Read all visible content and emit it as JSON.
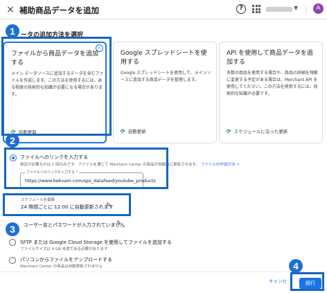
{
  "header": {
    "close_icon": "×",
    "title": "補助商品データを追加",
    "help_icon": "?",
    "avatar_initial": "A"
  },
  "callouts": [
    "1",
    "2",
    "3",
    "4"
  ],
  "section_heading": "ータの追加方法を選択",
  "cards": [
    {
      "title": "ファイルから商品データを追加する",
      "description": "メイン データソースに追加するデータを含むファイルを作成します。この方法を使用するには、ある程度の技術的な知識が必要になる場合があります。",
      "schedule": "自動更新",
      "selected": true
    },
    {
      "title": "Google スプレッドシートを使用する",
      "description": "Google スプレッドシートを使用して、メインソースに追加する商品データを管理します。",
      "schedule": "自動更新",
      "selected": false
    },
    {
      "title": "API を使用して商品データを追加する",
      "description": "多数の商品を使用する場合や、商品の詳細を頻繁に変更する予定がある場合は、Merchant API を使用してください。この方法を使用するには、技術的な知識が必要です。",
      "schedule": "スケジュールに沿った更新",
      "selected": false
    }
  ],
  "link_option": {
    "label": "ファイルへのリンクを入力する",
    "sublabel": "設定が必要なのは 1 回のみです。ファイルを通じて Merchant Center の商品が自動的に更新されます。",
    "help_link": "ファイルの作成方法",
    "field_label": "ファイルへのリンクを入力する *",
    "field_value": "https://www.bekvam.com/sps_datafeed/youtube_products"
  },
  "schedule_edit": {
    "label": "スケジュールを編集",
    "value": "24 時間ごとに 12:00 に自動更新されます"
  },
  "credentials_text": "ユーザー名とパスワードが入力されていません",
  "sftp_option": {
    "label": "SFTP または Google Cloud Storage を使用してファイルを追加する",
    "sublabel": "ファイルサイズは 4 GB 未満である必要があります"
  },
  "upload_option": {
    "label": "パソコンからファイルをアップロードする",
    "sublabel": "Merchant Center の商品は自動更新されません"
  },
  "footer": {
    "cancel_label": "キャンセル",
    "continue_label": "続行"
  },
  "colors": {
    "accent": "#1a73e8",
    "callout": "#1f6fd0",
    "schedule_icon": "#188038"
  }
}
